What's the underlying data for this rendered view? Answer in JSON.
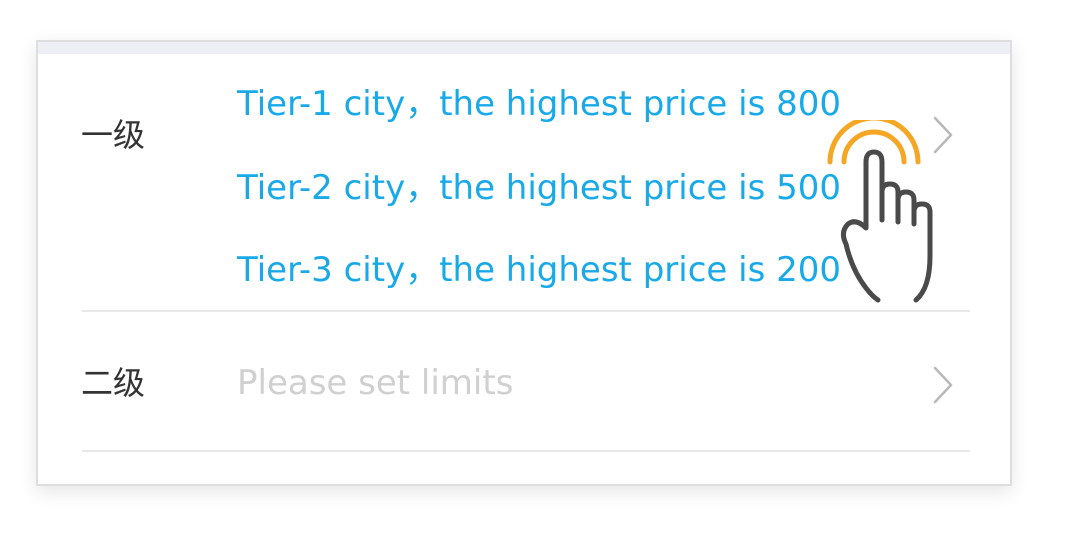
{
  "rows": [
    {
      "label": "一级",
      "tiers": [
        "Tier-1 city，the highest price is 800",
        "Tier-2 city，the highest price is 500",
        "Tier-3 city，the highest price is 200"
      ]
    },
    {
      "label": "二级",
      "placeholder": "Please set limits"
    }
  ],
  "colors": {
    "accent_blue": "#18a9e8",
    "placeholder_gray": "#d0d0d0",
    "label_dark": "#333333",
    "tap_orange": "#f5a623"
  },
  "icons": {
    "chevron": "chevron-right-icon",
    "gesture": "tap-hand-icon"
  }
}
